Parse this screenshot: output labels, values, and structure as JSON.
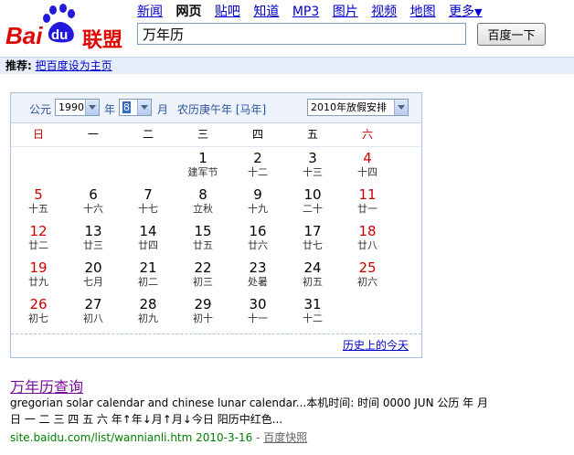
{
  "header": {
    "logo_text_bai": "Bai",
    "logo_text_du": "du",
    "logo_text_cn": "联盟",
    "nav": [
      {
        "label": "新闻",
        "active": false
      },
      {
        "label": "网页",
        "active": true
      },
      {
        "label": "贴吧",
        "active": false
      },
      {
        "label": "知道",
        "active": false
      },
      {
        "label": "MP3",
        "active": false
      },
      {
        "label": "图片",
        "active": false
      },
      {
        "label": "视频",
        "active": false
      },
      {
        "label": "地图",
        "active": false
      },
      {
        "label": "更多",
        "active": false
      }
    ],
    "more_arrow": "▼",
    "search_value": "万年历",
    "search_button": "百度一下"
  },
  "recommend": {
    "label": "推荐",
    "colon": ":",
    "link": "把百度设为主页"
  },
  "calendar": {
    "gongyuan": "公元",
    "year": "1990",
    "year_unit": "年",
    "month": "8",
    "month_unit": "月",
    "lunar_year": "农历庚午年 [马年]",
    "holiday_select": "2010年放假安排",
    "weekdays": [
      "日",
      "一",
      "二",
      "三",
      "四",
      "五",
      "六"
    ],
    "weeks": [
      [
        null,
        null,
        null,
        {
          "d": "1",
          "l": "建军节"
        },
        {
          "d": "2",
          "l": "十二"
        },
        {
          "d": "3",
          "l": "十三"
        },
        {
          "d": "4",
          "l": "十四"
        }
      ],
      [
        {
          "d": "5",
          "l": "十五"
        },
        {
          "d": "6",
          "l": "十六"
        },
        {
          "d": "7",
          "l": "十七"
        },
        {
          "d": "8",
          "l": "立秋"
        },
        {
          "d": "9",
          "l": "十九"
        },
        {
          "d": "10",
          "l": "二十"
        },
        {
          "d": "11",
          "l": "廿一"
        }
      ],
      [
        {
          "d": "12",
          "l": "廿二"
        },
        {
          "d": "13",
          "l": "廿三"
        },
        {
          "d": "14",
          "l": "廿四"
        },
        {
          "d": "15",
          "l": "廿五"
        },
        {
          "d": "16",
          "l": "廿六"
        },
        {
          "d": "17",
          "l": "廿七"
        },
        {
          "d": "18",
          "l": "廿八"
        }
      ],
      [
        {
          "d": "19",
          "l": "廿九"
        },
        {
          "d": "20",
          "l": "七月"
        },
        {
          "d": "21",
          "l": "初二"
        },
        {
          "d": "22",
          "l": "初三"
        },
        {
          "d": "23",
          "l": "处暑"
        },
        {
          "d": "24",
          "l": "初五"
        },
        {
          "d": "25",
          "l": "初六"
        }
      ],
      [
        {
          "d": "26",
          "l": "初七"
        },
        {
          "d": "27",
          "l": "初八"
        },
        {
          "d": "28",
          "l": "初九"
        },
        {
          "d": "29",
          "l": "初十"
        },
        {
          "d": "30",
          "l": "十一"
        },
        {
          "d": "31",
          "l": "十二"
        },
        null
      ]
    ],
    "history_link": "历史上的今天"
  },
  "result": {
    "title": "万年历查询",
    "desc_line1": "gregorian solar calendar and chinese lunar calendar...本机时间: 时间 0000 JUN 公历 年 月",
    "desc_line2": "日 一 二 三 四 五 六 年↑年↓月↑月↓今日 阳历中红色...",
    "url": "site.baidu.com/list/wannianli.htm 2010-3-16",
    "sep": " - ",
    "snapshot": "百度快照"
  },
  "colors": {
    "weekend_red": "#cc0000",
    "link_blue": "#0000cc",
    "url_green": "#008000",
    "logo_red": "#e10602",
    "logo_blue": "#2319dc"
  }
}
